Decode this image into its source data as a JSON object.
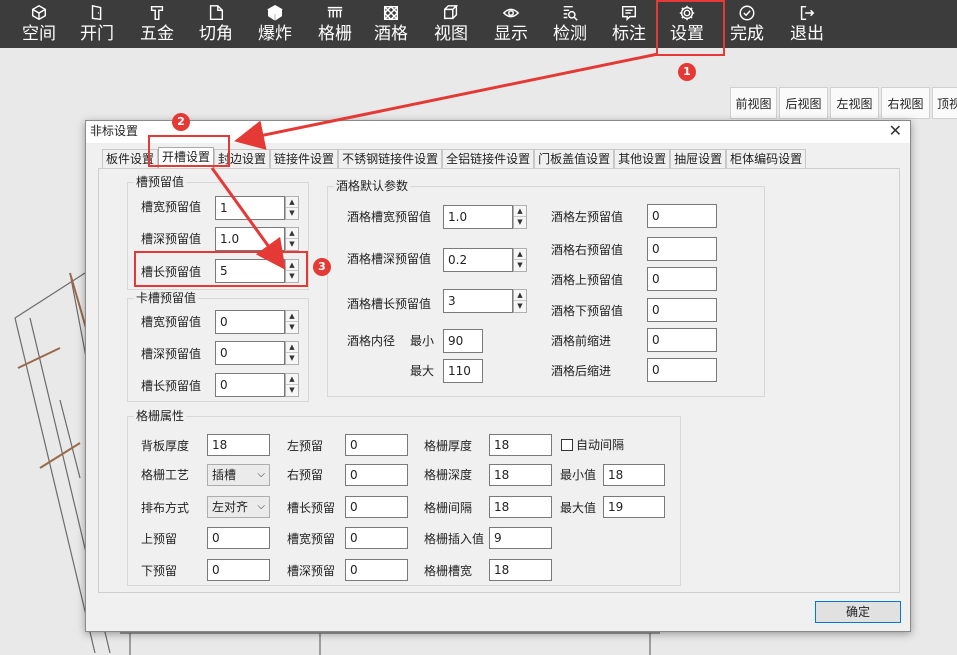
{
  "toolbar": {
    "items": [
      {
        "label": "空间",
        "icon": "cube-icon"
      },
      {
        "label": "开门",
        "icon": "door-icon"
      },
      {
        "label": "五金",
        "icon": "hardware-icon"
      },
      {
        "label": "切角",
        "icon": "cut-corner-icon"
      },
      {
        "label": "爆炸",
        "icon": "explode-icon"
      },
      {
        "label": "格栅",
        "icon": "grille-icon"
      },
      {
        "label": "酒格",
        "icon": "wine-rack-icon"
      },
      {
        "label": "视图",
        "icon": "view-icon"
      },
      {
        "label": "显示",
        "icon": "eye-icon"
      },
      {
        "label": "检测",
        "icon": "inspect-icon"
      },
      {
        "label": "标注",
        "icon": "annotate-icon"
      },
      {
        "label": "设置",
        "icon": "gear-icon"
      },
      {
        "label": "完成",
        "icon": "check-circle-icon"
      },
      {
        "label": "退出",
        "icon": "exit-icon"
      }
    ]
  },
  "views": [
    "前视图",
    "后视图",
    "左视图",
    "右视图",
    "顶视"
  ],
  "dialog": {
    "title": "非标设置",
    "close": "✕",
    "tabs": [
      "板件设置",
      "开槽设置",
      "封边设置",
      "链接件设置",
      "不锈钢链接件设置",
      "全铝链接件设置",
      "门板盖值设置",
      "其他设置",
      "抽屉设置",
      "柜体编码设置"
    ],
    "slot_reserve": {
      "title": "槽预留值",
      "rows": [
        {
          "label": "槽宽预留值",
          "value": "1"
        },
        {
          "label": "槽深预留值",
          "value": "1.0"
        },
        {
          "label": "槽长预留值",
          "value": "5"
        }
      ]
    },
    "clip_reserve": {
      "title": "卡槽预留值",
      "rows": [
        {
          "label": "槽宽预留值",
          "value": "0"
        },
        {
          "label": "槽深预留值",
          "value": "0"
        },
        {
          "label": "槽长预留值",
          "value": "0"
        }
      ]
    },
    "wine": {
      "title": "酒格默认参数",
      "slot_width_label": "酒格槽宽预留值",
      "slot_width": "1.0",
      "slot_depth_label": "酒格槽深预留值",
      "slot_depth": "0.2",
      "slot_length_label": "酒格槽长预留值",
      "slot_length": "3",
      "inner_label": "酒格内径",
      "min_label": "最小",
      "min": "90",
      "max_label": "最大",
      "max": "110",
      "right_col": [
        {
          "label": "酒格左预留值",
          "value": "0"
        },
        {
          "label": "酒格右预留值",
          "value": "0"
        },
        {
          "label": "酒格上预留值",
          "value": "0"
        },
        {
          "label": "酒格下预留值",
          "value": "0"
        },
        {
          "label": "酒格前缩进",
          "value": "0"
        },
        {
          "label": "酒格后缩进",
          "value": "0"
        }
      ]
    },
    "grille": {
      "title": "格栅属性",
      "back_thickness_label": "背板厚度",
      "back_thickness": "18",
      "craft_label": "格栅工艺",
      "craft": "插槽",
      "layout_label": "排布方式",
      "layout": "左对齐",
      "top_label": "上预留",
      "top": "0",
      "bottom_label": "下预留",
      "bottom": "0",
      "left_label": "左预留",
      "left": "0",
      "right_label": "右预留",
      "right": "0",
      "slot_len_label": "槽长预留",
      "slot_len": "0",
      "slot_wid_label": "槽宽预留",
      "slot_wid": "0",
      "slot_dep_label": "槽深预留",
      "slot_dep": "0",
      "thickness_label": "格栅厚度",
      "thickness": "18",
      "depth_label": "格栅深度",
      "depth": "18",
      "gap_label": "格栅间隔",
      "gap": "18",
      "insert_label": "格栅插入值",
      "insert": "9",
      "slot_width_label": "格栅槽宽",
      "slot_width": "18",
      "auto_gap_label": "自动间隔",
      "min_label": "最小值",
      "min": "18",
      "max_label": "最大值",
      "max": "19"
    },
    "ok": "确定"
  },
  "annotations": {
    "b1": "1",
    "b2": "2",
    "b3": "3"
  },
  "colors": {
    "toolbar": "#3c3c3c",
    "highlight": "#e53935",
    "ok_border": "#0078d7"
  }
}
